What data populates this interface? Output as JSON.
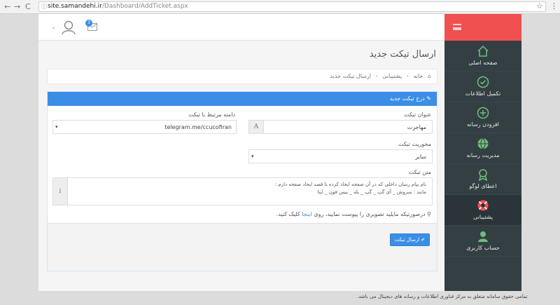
{
  "browser": {
    "url_host": "site.samandehi.ir",
    "url_path": "/Dashboard/AddTicket.aspx",
    "back": "←",
    "forward": "→",
    "reload": "C",
    "star": "☆",
    "menu": "⋮"
  },
  "topbar": {
    "notification_count": "3",
    "user_caret": "⌄"
  },
  "sidebar": {
    "items": [
      {
        "label": "صفحه اصلی",
        "icon": "home-icon"
      },
      {
        "label": "تکمیل اطلاعات",
        "icon": "check-circle-icon"
      },
      {
        "label": "افزودن رسانه",
        "icon": "plus-circle-icon"
      },
      {
        "label": "مدیریت رسانه",
        "icon": "globe-icon"
      },
      {
        "label": "اعطای لوگو",
        "icon": "award-icon"
      },
      {
        "label": "پشتیبانی",
        "icon": "lifebuoy-icon"
      },
      {
        "label": "حساب کاربری",
        "icon": "user-icon"
      }
    ],
    "active_index": 5,
    "accent_color": "#f05050",
    "bg_color": "#343f44"
  },
  "page": {
    "title": "ارسال تیکت جدید",
    "breadcrumb": [
      "خانه",
      "پشتیبانی",
      "ارسال تیکت جدید"
    ]
  },
  "form": {
    "panel_title": "درج تیکت جدید",
    "ticket_title_label": "عنوان تیکت",
    "ticket_title_value": "مهاجرت",
    "domain_label": "دامنه مرتبط با تیکت",
    "domain_value": "telegram.me/ccucofiran",
    "priority_label": "محوریت تیکت",
    "priority_value": "سایر",
    "body_label": "متن تیکت",
    "body_line1": "نام پیام رسان داخلی که در آن صفحه ایجاد کرده یا قصد ایجاد صفحه دارم :",
    "body_line2": "مانند : سروش _ آی گپ _ گپ _ بله _ بیس فون _ ایتا",
    "upload_note_prefix": "درصورتیکه مایلید تصویری را پیوست نمایید، روی",
    "upload_link": "اینجا",
    "upload_note_suffix": "کلیک کنید.",
    "submit_label": "ارسال تیکت",
    "primary_color": "#3a8ee6"
  },
  "footer": {
    "text": "تمامی حقوق سامانه متعلق به مرکز فناوری اطلاعات و رسانه های دیجیتال می باشد."
  }
}
